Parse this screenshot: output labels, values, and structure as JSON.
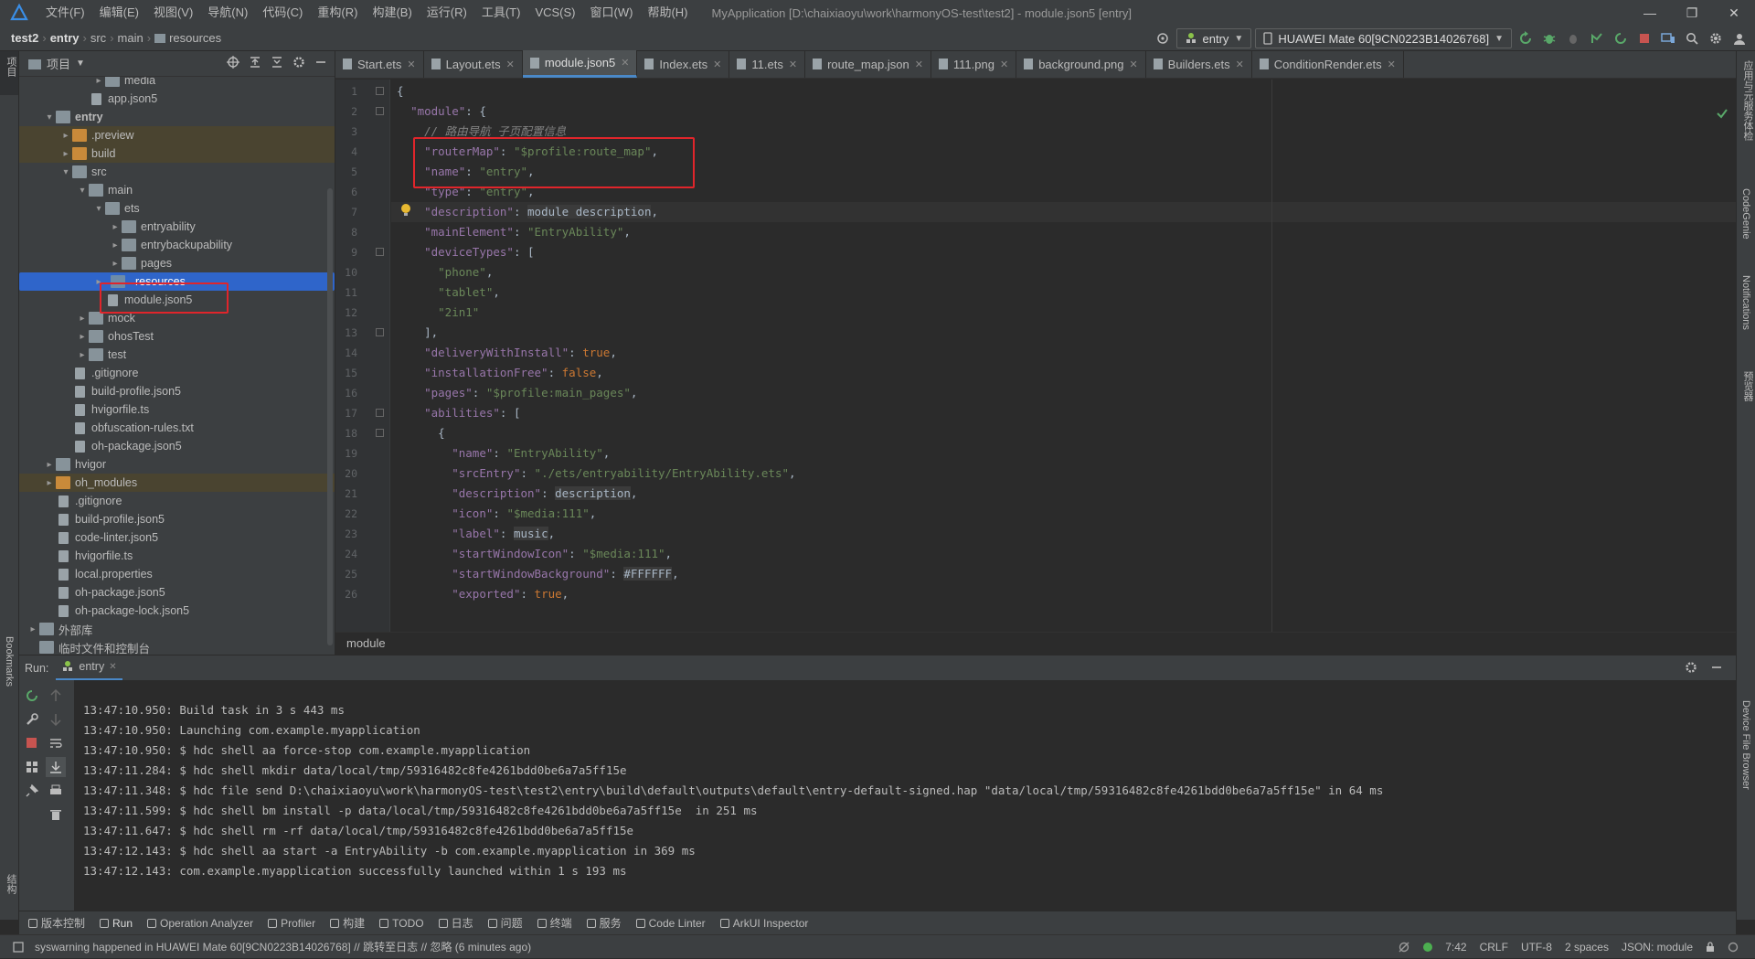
{
  "titlebar": {
    "menu": [
      "文件(F)",
      "编辑(E)",
      "视图(V)",
      "导航(N)",
      "代码(C)",
      "重构(R)",
      "构建(B)",
      "运行(R)",
      "工具(T)",
      "VCS(S)",
      "窗口(W)",
      "帮助(H)"
    ],
    "title": "MyApplication [D:\\chaixiaoyu\\work\\harmonyOS-test\\test2] - module.json5 [entry]",
    "min": "—",
    "max": "❐",
    "close": "✕"
  },
  "navbar": {
    "crumbs": [
      "test2",
      "entry",
      "src",
      "main",
      "resources"
    ],
    "run_config": "entry",
    "device": "HUAWEI Mate 60[9CN0223B14026768]"
  },
  "project": {
    "header": "项目",
    "rows": [
      {
        "label": "media",
        "depth": 4,
        "type": "folder",
        "arrow": "▸",
        "style": ""
      },
      {
        "label": "app.json5",
        "depth": 3,
        "type": "file",
        "arrow": "",
        "style": ""
      },
      {
        "label": "entry",
        "depth": 1,
        "type": "folder",
        "arrow": "▾",
        "style": "",
        "bold": true
      },
      {
        "label": ".preview",
        "depth": 2,
        "type": "folder-or",
        "arrow": "▸",
        "style": "excl"
      },
      {
        "label": "build",
        "depth": 2,
        "type": "folder-or",
        "arrow": "▸",
        "style": "excl"
      },
      {
        "label": "src",
        "depth": 2,
        "type": "folder",
        "arrow": "▾",
        "style": ""
      },
      {
        "label": "main",
        "depth": 3,
        "type": "folder",
        "arrow": "▾",
        "style": ""
      },
      {
        "label": "ets",
        "depth": 4,
        "type": "folder",
        "arrow": "▾",
        "style": ""
      },
      {
        "label": "entryability",
        "depth": 5,
        "type": "folder",
        "arrow": "▸",
        "style": ""
      },
      {
        "label": "entrybackupability",
        "depth": 5,
        "type": "folder",
        "arrow": "▸",
        "style": ""
      },
      {
        "label": "pages",
        "depth": 5,
        "type": "folder",
        "arrow": "▸",
        "style": ""
      },
      {
        "label": "resources",
        "depth": 4,
        "type": "folder-bl",
        "arrow": "▸",
        "style": "sel"
      },
      {
        "label": "module.json5",
        "depth": 4,
        "type": "file",
        "arrow": "",
        "style": ""
      },
      {
        "label": "mock",
        "depth": 3,
        "type": "folder",
        "arrow": "▸",
        "style": ""
      },
      {
        "label": "ohosTest",
        "depth": 3,
        "type": "folder",
        "arrow": "▸",
        "style": ""
      },
      {
        "label": "test",
        "depth": 3,
        "type": "folder",
        "arrow": "▸",
        "style": ""
      },
      {
        "label": ".gitignore",
        "depth": 2,
        "type": "file",
        "arrow": "",
        "style": ""
      },
      {
        "label": "build-profile.json5",
        "depth": 2,
        "type": "file",
        "arrow": "",
        "style": ""
      },
      {
        "label": "hvigorfile.ts",
        "depth": 2,
        "type": "file",
        "arrow": "",
        "style": ""
      },
      {
        "label": "obfuscation-rules.txt",
        "depth": 2,
        "type": "file",
        "arrow": "",
        "style": ""
      },
      {
        "label": "oh-package.json5",
        "depth": 2,
        "type": "file",
        "arrow": "",
        "style": ""
      },
      {
        "label": "hvigor",
        "depth": 1,
        "type": "folder",
        "arrow": "▸",
        "style": ""
      },
      {
        "label": "oh_modules",
        "depth": 1,
        "type": "folder-or",
        "arrow": "▸",
        "style": "excl"
      },
      {
        "label": ".gitignore",
        "depth": 1,
        "type": "file",
        "arrow": "",
        "style": ""
      },
      {
        "label": "build-profile.json5",
        "depth": 1,
        "type": "file",
        "arrow": "",
        "style": ""
      },
      {
        "label": "code-linter.json5",
        "depth": 1,
        "type": "file",
        "arrow": "",
        "style": ""
      },
      {
        "label": "hvigorfile.ts",
        "depth": 1,
        "type": "file",
        "arrow": "",
        "style": ""
      },
      {
        "label": "local.properties",
        "depth": 1,
        "type": "file",
        "arrow": "",
        "style": ""
      },
      {
        "label": "oh-package.json5",
        "depth": 1,
        "type": "file",
        "arrow": "",
        "style": ""
      },
      {
        "label": "oh-package-lock.json5",
        "depth": 1,
        "type": "file",
        "arrow": "",
        "style": ""
      },
      {
        "label": "外部库",
        "depth": 0,
        "type": "lib",
        "arrow": "▸",
        "style": ""
      },
      {
        "label": "临时文件和控制台",
        "depth": 0,
        "type": "lib",
        "arrow": "",
        "style": ""
      }
    ]
  },
  "editor": {
    "tabs": [
      {
        "label": "Start.ets",
        "active": false
      },
      {
        "label": "Layout.ets",
        "active": false
      },
      {
        "label": "module.json5",
        "active": true
      },
      {
        "label": "Index.ets",
        "active": false
      },
      {
        "label": "11.ets",
        "active": false
      },
      {
        "label": "route_map.json",
        "active": false
      },
      {
        "label": "111.png",
        "active": false
      },
      {
        "label": "background.png",
        "active": false
      },
      {
        "label": "Builders.ets",
        "active": false
      },
      {
        "label": "ConditionRender.ets",
        "active": false
      }
    ],
    "lines": [
      [
        [
          "p",
          "{"
        ]
      ],
      [
        [
          "p",
          "  "
        ],
        [
          "k",
          "\"module\""
        ],
        [
          "p",
          ": {"
        ]
      ],
      [
        [
          "p",
          "    "
        ],
        [
          "c",
          "// 路由导航 子页配置信息"
        ]
      ],
      [
        [
          "p",
          "    "
        ],
        [
          "k",
          "\"routerMap\""
        ],
        [
          "p",
          ": "
        ],
        [
          "s",
          "\"$profile:route_map\""
        ],
        [
          "p",
          ","
        ]
      ],
      [
        [
          "p",
          "    "
        ],
        [
          "k",
          "\"name\""
        ],
        [
          "p",
          ": "
        ],
        [
          "s",
          "\"entry\""
        ],
        [
          "p",
          ","
        ]
      ],
      [
        [
          "p",
          "    "
        ],
        [
          "k",
          "\"type\""
        ],
        [
          "p",
          ": "
        ],
        [
          "s",
          "\"entry\""
        ],
        [
          "p",
          ","
        ]
      ],
      [
        [
          "p",
          "    "
        ],
        [
          "k",
          "\"description\""
        ],
        [
          "p",
          ": "
        ],
        [
          "hl",
          "module description"
        ],
        [
          "p",
          ","
        ]
      ],
      [
        [
          "p",
          "    "
        ],
        [
          "k",
          "\"mainElement\""
        ],
        [
          "p",
          ": "
        ],
        [
          "s",
          "\"EntryAbility\""
        ],
        [
          "p",
          ","
        ]
      ],
      [
        [
          "p",
          "    "
        ],
        [
          "k",
          "\"deviceTypes\""
        ],
        [
          "p",
          ": ["
        ]
      ],
      [
        [
          "p",
          "      "
        ],
        [
          "s",
          "\"phone\""
        ],
        [
          "p",
          ","
        ]
      ],
      [
        [
          "p",
          "      "
        ],
        [
          "s",
          "\"tablet\""
        ],
        [
          "p",
          ","
        ]
      ],
      [
        [
          "p",
          "      "
        ],
        [
          "s",
          "\"2in1\""
        ]
      ],
      [
        [
          "p",
          "    ],"
        ]
      ],
      [
        [
          "p",
          "    "
        ],
        [
          "k",
          "\"deliveryWithInstall\""
        ],
        [
          "p",
          ": "
        ],
        [
          "b",
          "true"
        ],
        [
          "p",
          ","
        ]
      ],
      [
        [
          "p",
          "    "
        ],
        [
          "k",
          "\"installationFree\""
        ],
        [
          "p",
          ": "
        ],
        [
          "b",
          "false"
        ],
        [
          "p",
          ","
        ]
      ],
      [
        [
          "p",
          "    "
        ],
        [
          "k",
          "\"pages\""
        ],
        [
          "p",
          ": "
        ],
        [
          "s",
          "\"$profile:main_pages\""
        ],
        [
          "p",
          ","
        ]
      ],
      [
        [
          "p",
          "    "
        ],
        [
          "k",
          "\"abilities\""
        ],
        [
          "p",
          ": ["
        ]
      ],
      [
        [
          "p",
          "      {"
        ]
      ],
      [
        [
          "p",
          "        "
        ],
        [
          "k",
          "\"name\""
        ],
        [
          "p",
          ": "
        ],
        [
          "s",
          "\"EntryAbility\""
        ],
        [
          "p",
          ","
        ]
      ],
      [
        [
          "p",
          "        "
        ],
        [
          "k",
          "\"srcEntry\""
        ],
        [
          "p",
          ": "
        ],
        [
          "s",
          "\"./ets/entryability/EntryAbility.ets\""
        ],
        [
          "p",
          ","
        ]
      ],
      [
        [
          "p",
          "        "
        ],
        [
          "k",
          "\"description\""
        ],
        [
          "p",
          ": "
        ],
        [
          "hl",
          "description"
        ],
        [
          "p",
          ","
        ]
      ],
      [
        [
          "p",
          "        "
        ],
        [
          "k",
          "\"icon\""
        ],
        [
          "p",
          ": "
        ],
        [
          "s",
          "\"$media:111\""
        ],
        [
          "p",
          ","
        ]
      ],
      [
        [
          "p",
          "        "
        ],
        [
          "k",
          "\"label\""
        ],
        [
          "p",
          ": "
        ],
        [
          "hl",
          "music"
        ],
        [
          "p",
          ","
        ]
      ],
      [
        [
          "p",
          "        "
        ],
        [
          "k",
          "\"startWindowIcon\""
        ],
        [
          "p",
          ": "
        ],
        [
          "s",
          "\"$media:111\""
        ],
        [
          "p",
          ","
        ]
      ],
      [
        [
          "p",
          "        "
        ],
        [
          "k",
          "\"startWindowBackground\""
        ],
        [
          "p",
          ": "
        ],
        [
          "hl",
          "#FFFFFF"
        ],
        [
          "p",
          ","
        ]
      ],
      [
        [
          "p",
          "        "
        ],
        [
          "k",
          "\"exported\""
        ],
        [
          "p",
          ": "
        ],
        [
          "b",
          "true"
        ],
        [
          "p",
          ","
        ]
      ]
    ],
    "breadcrumb": "module"
  },
  "run": {
    "label": "Run:",
    "tab": "entry",
    "console": [
      "13:47:10.950: Build task in 3 s 443 ms",
      "13:47:10.950: Launching com.example.myapplication",
      "13:47:10.950: $ hdc shell aa force-stop com.example.myapplication",
      "13:47:11.284: $ hdc shell mkdir data/local/tmp/59316482c8fe4261bdd0be6a7a5ff15e",
      "13:47:11.348: $ hdc file send D:\\chaixiaoyu\\work\\harmonyOS-test\\test2\\entry\\build\\default\\outputs\\default\\entry-default-signed.hap \"data/local/tmp/59316482c8fe4261bdd0be6a7a5ff15e\" in 64 ms",
      "13:47:11.599: $ hdc shell bm install -p data/local/tmp/59316482c8fe4261bdd0be6a7a5ff15e  in 251 ms",
      "13:47:11.647: $ hdc shell rm -rf data/local/tmp/59316482c8fe4261bdd0be6a7a5ff15e",
      "13:47:12.143: $ hdc shell aa start -a EntryAbility -b com.example.myapplication in 369 ms",
      "13:47:12.143: com.example.myapplication successfully launched within 1 s 193 ms"
    ]
  },
  "tooltabs": [
    "版本控制",
    "Run",
    "Operation Analyzer",
    "Profiler",
    "构建",
    "TODO",
    "日志",
    "问题",
    "终端",
    "服务",
    "Code Linter",
    "ArkUI Inspector"
  ],
  "status": {
    "message": "syswarning happened in HUAWEI Mate 60[9CN0223B14026768] // 跳转至日志 // 忽略 (6 minutes ago)",
    "position": "7:42",
    "line_sep": "CRLF",
    "encoding": "UTF-8",
    "indent": "2 spaces",
    "schema": "JSON: module"
  },
  "stripes": {
    "left_top": "项目",
    "left_bottom1": "Bookmarks",
    "left_bottom2": "结构",
    "right1": "应用与元服务体检",
    "right2": "CodeGenie",
    "right3": "Notifications",
    "right4": "预览器",
    "right5": "Device File Browser"
  },
  "colors": {
    "accent": "#2f65ca",
    "redbox": "#e0252b",
    "excluded": "#4a4430",
    "run_green": "#4caf50"
  }
}
